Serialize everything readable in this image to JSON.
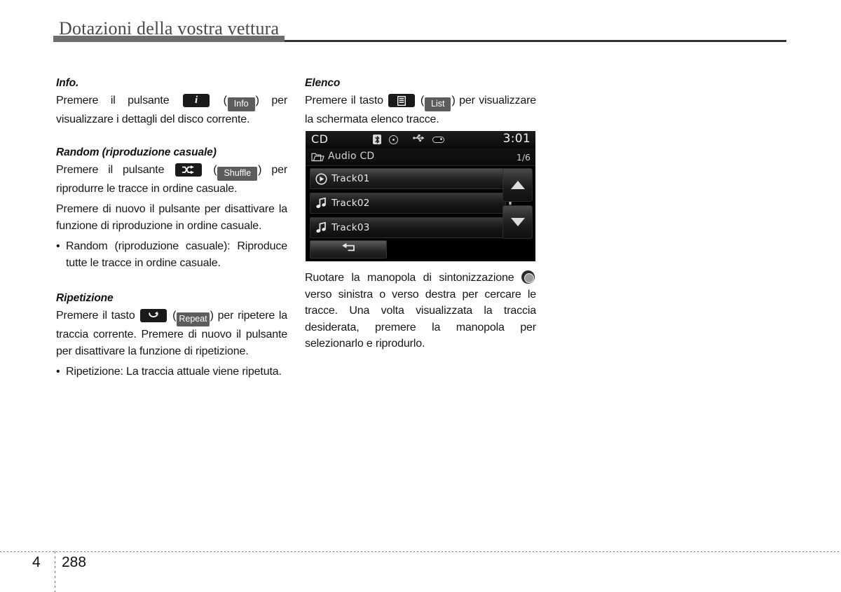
{
  "header": {
    "chapter_title": "Dotazioni della vostra vettura"
  },
  "left_column": {
    "info": {
      "heading": "Info.",
      "text_before": "Premere il pulsante",
      "key_icon": "info-i-key",
      "paren_open": "(",
      "softkey_label": "Info",
      "paren_close": ")",
      "text_after": "per visualizzare i dettagli del disco corrente."
    },
    "random": {
      "heading": "Random (riproduzione casuale)",
      "text_before": "Premere il pulsante",
      "key_icon": "shuffle-key",
      "paren_open": "(",
      "softkey_label": "Shuffle",
      "paren_close": ")",
      "text_after": "per riprodurre le tracce in ordine casuale.",
      "paragraph2": "Premere di nuovo il pulsante per disattivare la funzione di riproduzione in ordine casuale.",
      "bullet": {
        "marker": "•",
        "text": "Random (riproduzione casuale): Riproduce tutte le tracce in ordine casuale."
      }
    },
    "repeat": {
      "heading": "Ripetizione",
      "text_before": "Premere il tasto",
      "key_icon": "repeat-key",
      "paren_open": "(",
      "softkey_label": "Repeat",
      "paren_close": ")",
      "text_after": "per ripetere la traccia corrente. Premere di nuovo il pulsante per disattivare la funzione di ripetizione.",
      "bullet": {
        "marker": "•",
        "text": "Ripetizione: La traccia attuale viene ripetuta."
      }
    }
  },
  "right_column": {
    "list": {
      "heading": "Elenco",
      "text_before": "Premere il tasto",
      "key_icon": "list-key",
      "paren_open": "(",
      "softkey_label": "List",
      "paren_close": ")",
      "text_after": "per visualizzare la schermata elenco tracce."
    },
    "knob_paragraph": {
      "text_before": "Ruotare la manopola di sintonizzazione",
      "knob_icon": "tuning-knob-icon",
      "text_after": "verso sinistra o verso destra per cercare le tracce. Una volta visualizzata la traccia desiderata, premere la manopola per selezionarlo e riprodurlo."
    }
  },
  "cd_screen": {
    "status_bar": {
      "source": "CD",
      "clock": "3:01",
      "icons": [
        "bluetooth-icon",
        "disc-icon",
        "usb-icon",
        "usb-drive-icon"
      ]
    },
    "folder_bar": {
      "folder_icon": "folder-icon",
      "label": "Audio CD",
      "count": "1/6"
    },
    "tracks": [
      {
        "label": "Track01",
        "icon": "play-circle-icon",
        "playing": true
      },
      {
        "label": "Track02",
        "icon": "music-note-icon",
        "playing": false
      },
      {
        "label": "Track03",
        "icon": "music-note-icon",
        "playing": false
      }
    ],
    "scroll": {
      "up_icon": "arrow-up-icon",
      "down_icon": "arrow-down-icon"
    },
    "back_button": {
      "icon": "back-arrow-icon"
    }
  },
  "footer": {
    "chapter_number": "4",
    "page_number": "288"
  }
}
